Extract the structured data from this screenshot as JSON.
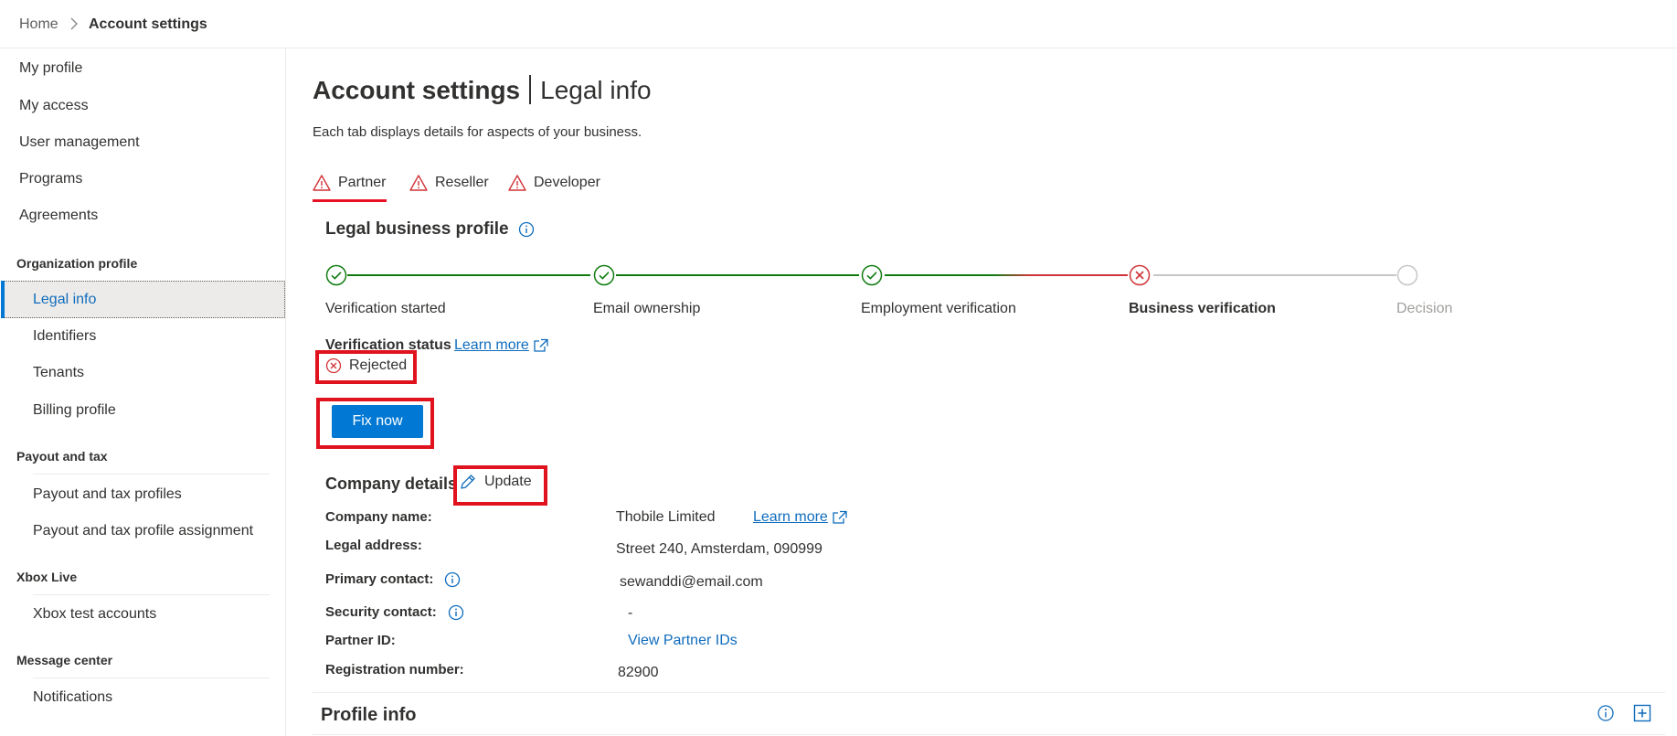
{
  "breadcrumb": {
    "home": "Home",
    "current": "Account settings"
  },
  "sidebar": {
    "top_items": [
      "My profile",
      "My access",
      "User management",
      "Programs",
      "Agreements"
    ],
    "org_profile": {
      "heading": "Organization profile",
      "items": [
        "Legal info",
        "Identifiers",
        "Tenants",
        "Billing profile"
      ],
      "selected": "Legal info"
    },
    "payout": {
      "heading": "Payout and tax",
      "items": [
        "Payout and tax profiles",
        "Payout and tax profile assignment"
      ]
    },
    "xbox": {
      "heading": "Xbox Live",
      "items": [
        "Xbox test accounts"
      ]
    },
    "messages": {
      "heading": "Message center",
      "items": [
        "Notifications"
      ]
    }
  },
  "header": {
    "title": "Account settings",
    "subtitle": "Legal info",
    "description": "Each tab displays details for aspects of your business."
  },
  "tabs": [
    {
      "label": "Partner",
      "status": "warning",
      "active": true
    },
    {
      "label": "Reseller",
      "status": "warning",
      "active": false
    },
    {
      "label": "Developer",
      "status": "warning",
      "active": false
    }
  ],
  "legal_profile": {
    "title": "Legal business profile",
    "steps": [
      {
        "label": "Verification started",
        "status": "complete"
      },
      {
        "label": "Email ownership",
        "status": "complete"
      },
      {
        "label": "Employment verification",
        "status": "complete"
      },
      {
        "label": "Business verification",
        "status": "failed"
      },
      {
        "label": "Decision",
        "status": "pending"
      }
    ],
    "verification_status_label": "Verification status",
    "learn_more": "Learn more",
    "status": "Rejected",
    "fix_button": "Fix now"
  },
  "company": {
    "title": "Company details",
    "update_button": "Update",
    "fields": {
      "company_name": {
        "label": "Company name:",
        "value": "Thobile Limited",
        "link": "Learn more"
      },
      "legal_address": {
        "label": "Legal address:",
        "value": "Street 240, Amsterdam, 090999"
      },
      "primary_contact": {
        "label": "Primary contact:",
        "value": "sewanddi@email.com"
      },
      "security_contact": {
        "label": "Security contact:",
        "value": "-"
      },
      "partner_id": {
        "label": "Partner ID:",
        "value": "View Partner IDs"
      },
      "registration_number": {
        "label": "Registration number:",
        "value": "82900"
      }
    }
  },
  "profile_info": {
    "title": "Profile info"
  },
  "colors": {
    "accent": "#0078d4",
    "success": "#107c10",
    "error": "#d13438",
    "highlight_box": "#e0121d",
    "pending": "#c8c6c4"
  }
}
